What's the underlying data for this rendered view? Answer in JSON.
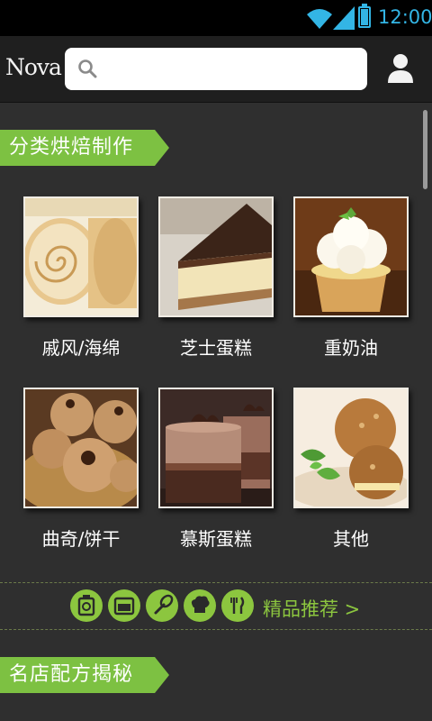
{
  "status_bar": {
    "time": "12:00"
  },
  "header": {
    "logo": "Nova",
    "search_placeholder": ""
  },
  "sections": [
    {
      "title": "分类烘焙制作"
    },
    {
      "title": "名店配方揭秘"
    }
  ],
  "categories": [
    {
      "label": "戚风/海绵",
      "image": "swiss-roll"
    },
    {
      "label": "芝士蛋糕",
      "image": "cheesecake"
    },
    {
      "label": "重奶油",
      "image": "cupcake"
    },
    {
      "label": "曲奇/饼干",
      "image": "cookies"
    },
    {
      "label": "慕斯蛋糕",
      "image": "mousse"
    },
    {
      "label": "其他",
      "image": "cream-puff"
    }
  ],
  "quick_links": {
    "icons": [
      "scale-icon",
      "oven-icon",
      "whisk-icon",
      "chef-hat-icon",
      "utensils-icon"
    ],
    "recommend_label": "精品推荐 >"
  },
  "colors": {
    "accent": "#7dc142",
    "status_blue": "#33b5e5",
    "background": "#2f2f2f"
  }
}
